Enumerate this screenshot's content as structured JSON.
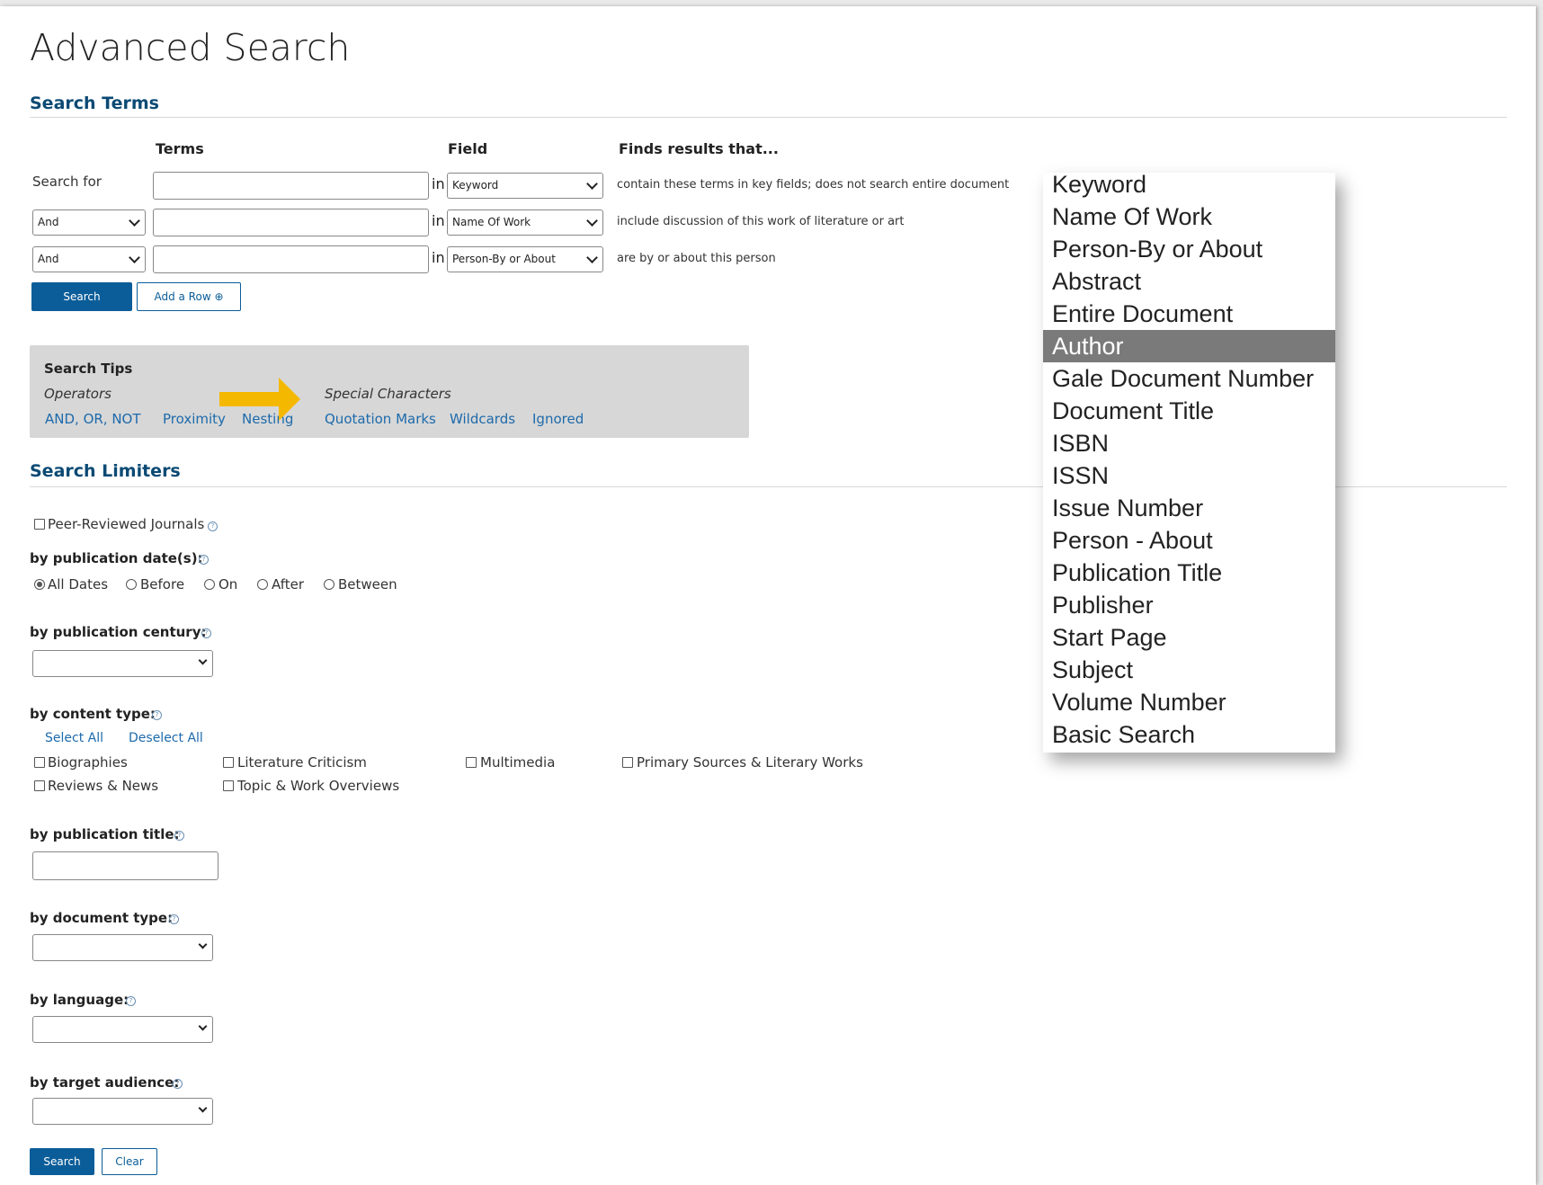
{
  "page": {
    "title": "Advanced Search"
  },
  "search_terms": {
    "title": "Search Terms",
    "col_terms": "Terms",
    "col_field": "Field",
    "col_finds": "Finds results that...",
    "search_for_label": "Search for",
    "in_label": "in",
    "rows": [
      {
        "operator": "",
        "field": "Keyword",
        "desc": "contain these terms in key fields; does not search entire document",
        "value": ""
      },
      {
        "operator": "And",
        "field": "Name Of Work",
        "desc": "include discussion of this work of literature or art",
        "value": ""
      },
      {
        "operator": "And",
        "field": "Person-By or About",
        "desc": "are by or about this person",
        "value": ""
      }
    ],
    "search_button": "Search",
    "add_row_button": "Add a Row ⊕"
  },
  "search_tips": {
    "title": "Search Tips",
    "operators_label": "Operators",
    "special_label": "Special Characters",
    "operator_links": [
      "AND, OR, NOT",
      "Proximity",
      "Nesting"
    ],
    "special_links": [
      "Quotation Marks",
      "Wildcards",
      "Ignored"
    ],
    "arrow_color": "#f5b800"
  },
  "search_limiters": {
    "title": "Search Limiters",
    "peer_reviewed": "Peer-Reviewed Journals",
    "pub_dates_label": "by publication date(s):",
    "date_options": [
      "All Dates",
      "Before",
      "On",
      "After",
      "Between"
    ],
    "date_selected": "All Dates",
    "century_label": "by publication century:",
    "content_type_label": "by content type:",
    "select_all": "Select All",
    "deselect_all": "Deselect All",
    "content_types": [
      "Biographies",
      "Literature Criticism",
      "Multimedia",
      "Primary Sources & Literary Works",
      "Reviews & News",
      "Topic & Work Overviews"
    ],
    "pub_title_label": "by publication title:",
    "doc_type_label": "by document type:",
    "language_label": "by language:",
    "audience_label": "by target audience:",
    "search_button": "Search",
    "clear_button": "Clear"
  },
  "field_dropdown": {
    "options": [
      "Keyword",
      "Name Of Work",
      "Person-By or About",
      "Abstract",
      "Entire Document",
      "Author",
      "Gale Document Number",
      "Document Title",
      "ISBN",
      "ISSN",
      "Issue Number",
      "Person - About",
      "Publication Title",
      "Publisher",
      "Start Page",
      "Subject",
      "Volume Number",
      "Basic Search"
    ],
    "highlighted": "Author"
  },
  "colors": {
    "heading_blue": "#0b4a74",
    "link_blue": "#1d6aab",
    "button_blue": "#0b5d99",
    "tips_bg": "#d7d7d7"
  }
}
